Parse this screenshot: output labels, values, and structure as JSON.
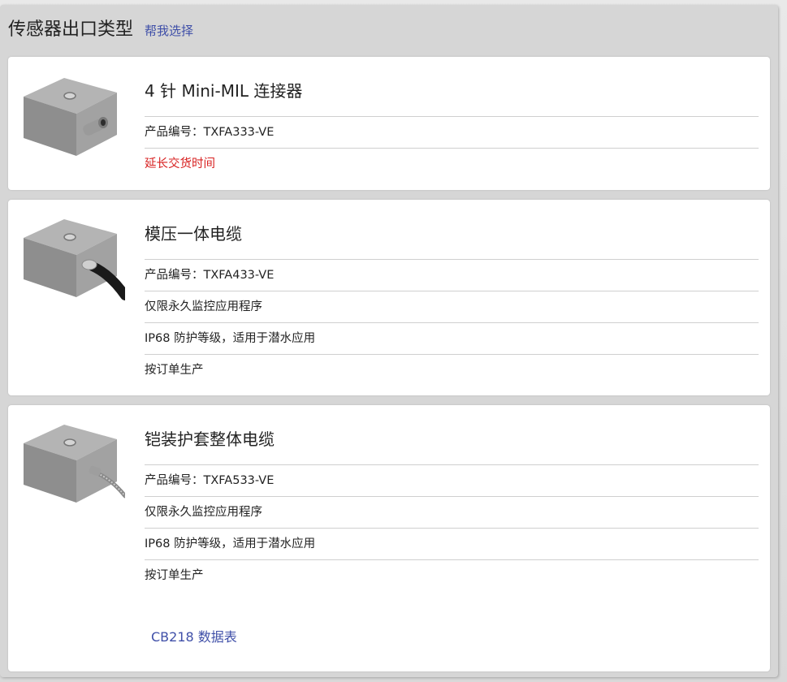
{
  "header": {
    "title": "传感器出口类型",
    "help_link": "帮我选择"
  },
  "cards": [
    {
      "title": "4 针 Mini-MIL 连接器",
      "rows": [
        "产品编号：TXFA333-VE",
        "延长交货时间"
      ]
    },
    {
      "title": "模压一体电缆",
      "rows": [
        "产品编号：TXFA433-VE",
        "仅限永久监控应用程序",
        "IP68 防护等级，适用于潜水应用",
        "按订单生产"
      ]
    },
    {
      "title": "铠装护套整体电缆",
      "rows": [
        "产品编号：TXFA533-VE",
        "仅限永久监控应用程序",
        "IP68 防护等级，适用于潜水应用",
        "按订单生产"
      ],
      "datasheet_link": "CB218 数据表"
    }
  ],
  "colors": {
    "accent_link": "#3f4fa8",
    "warning": "#d71f1f"
  }
}
